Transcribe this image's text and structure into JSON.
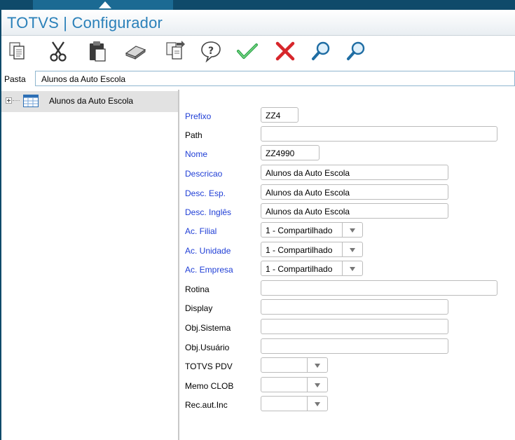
{
  "window": {
    "title": "TOTVS | Configurador"
  },
  "toolbar": {
    "buttons": [
      {
        "icon": "copy-icon"
      },
      {
        "icon": "cut-icon"
      },
      {
        "icon": "paste-icon"
      },
      {
        "icon": "eraser-icon"
      },
      {
        "icon": "export-icon"
      },
      {
        "icon": "help-icon"
      },
      {
        "icon": "confirm-check-icon"
      },
      {
        "icon": "cancel-x-icon"
      },
      {
        "icon": "search-icon"
      },
      {
        "icon": "search-next-icon"
      }
    ]
  },
  "pasta": {
    "label": "Pasta",
    "value": "Alunos da Auto Escola"
  },
  "tree": {
    "items": [
      {
        "label": "Alunos da Auto Escola",
        "icon": "table-icon"
      }
    ]
  },
  "form": {
    "prefixo": {
      "label": "Prefixo",
      "value": "ZZ4"
    },
    "path": {
      "label": "Path",
      "value": ""
    },
    "nome": {
      "label": "Nome",
      "value": "ZZ4990"
    },
    "descricao": {
      "label": "Descricao",
      "value": "Alunos da Auto Escola"
    },
    "desc_esp": {
      "label": "Desc. Esp.",
      "value": "Alunos da Auto Escola"
    },
    "desc_ingles": {
      "label": "Desc. Inglês",
      "value": "Alunos da Auto Escola"
    },
    "ac_filial": {
      "label": "Ac. Filial",
      "value": "1 - Compartilhado"
    },
    "ac_unidade": {
      "label": "Ac. Unidade",
      "value": "1 - Compartilhado"
    },
    "ac_empresa": {
      "label": "Ac. Empresa",
      "value": "1 - Compartilhado"
    },
    "rotina": {
      "label": "Rotina",
      "value": ""
    },
    "display": {
      "label": "Display",
      "value": ""
    },
    "obj_sistema": {
      "label": "Obj.Sistema",
      "value": ""
    },
    "obj_usuario": {
      "label": "Obj.Usuário",
      "value": ""
    },
    "totvs_pdv": {
      "label": "TOTVS PDV",
      "value": ""
    },
    "memo_clob": {
      "label": "Memo CLOB",
      "value": ""
    },
    "rec_aut_inc": {
      "label": "Rec.aut.Inc",
      "value": ""
    }
  },
  "colors": {
    "accent": "#2a80b9",
    "required_label": "#1f3ed6",
    "frame_border": "#0f4a6a"
  }
}
